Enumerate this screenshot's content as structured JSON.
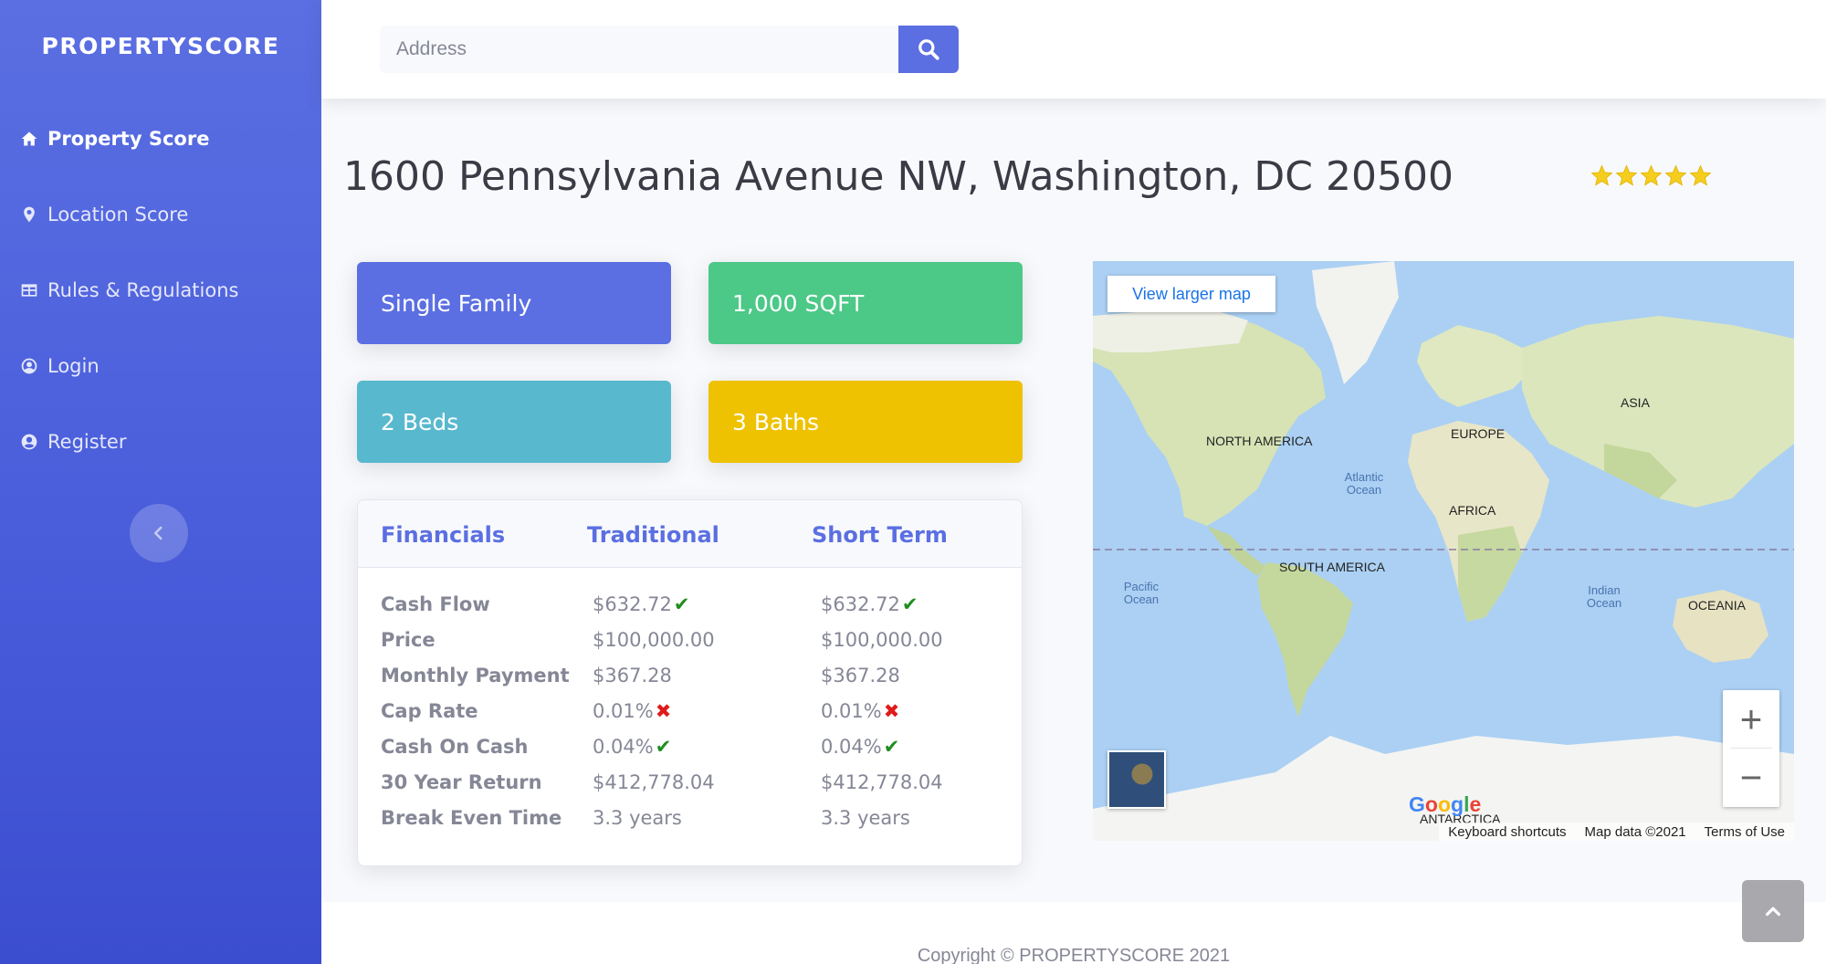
{
  "brand": "PROPERTYSCORE",
  "sidebar": {
    "items": [
      {
        "label": "Property Score",
        "icon": "home-icon"
      },
      {
        "label": "Location Score",
        "icon": "map-marker-icon"
      },
      {
        "label": "Rules & Regulations",
        "icon": "table-icon"
      },
      {
        "label": "Login",
        "icon": "user-circle-icon"
      },
      {
        "label": "Register",
        "icon": "user-icon"
      }
    ]
  },
  "search": {
    "placeholder": "Address",
    "value": ""
  },
  "property": {
    "address": "1600 Pennsylvania Avenue NW, Washington, DC 20500",
    "rating": 5,
    "type": "Single Family",
    "sqft": "1,000 SQFT",
    "beds": "2 Beds",
    "baths": "3 Baths"
  },
  "financials": {
    "headers": [
      "Financials",
      "Traditional",
      "Short Term"
    ],
    "rows": [
      {
        "label": "Cash Flow",
        "traditional": "$632.72",
        "short_term": "$632.72",
        "status": "check"
      },
      {
        "label": "Price",
        "traditional": "$100,000.00",
        "short_term": "$100,000.00",
        "status": ""
      },
      {
        "label": "Monthly Payment",
        "traditional": "$367.28",
        "short_term": "$367.28",
        "status": ""
      },
      {
        "label": "Cap Rate",
        "traditional": "0.01%",
        "short_term": "0.01%",
        "status": "cross"
      },
      {
        "label": "Cash On Cash",
        "traditional": "0.04%",
        "short_term": "0.04%",
        "status": "check"
      },
      {
        "label": "30 Year Return",
        "traditional": "$412,778.04",
        "short_term": "$412,778.04",
        "status": ""
      },
      {
        "label": "Break Even Time",
        "traditional": "3.3 years",
        "short_term": "3.3 years",
        "status": ""
      }
    ]
  },
  "map": {
    "view_larger": "View larger map",
    "zoom_in": "+",
    "zoom_out": "−",
    "footer": [
      "Keyboard shortcuts",
      "Map data ©2021",
      "Terms of Use"
    ],
    "logo": "Google",
    "labels": {
      "north_america": "NORTH AMERICA",
      "south_america": "SOUTH AMERICA",
      "europe": "EUROPE",
      "africa": "AFRICA",
      "asia": "ASIA",
      "oceania": "OCEANIA",
      "antarctica": "ANTARCTICA",
      "atlantic": "Atlantic Ocean",
      "pacific": "Pacific Ocean",
      "indian": "Indian Ocean"
    }
  },
  "footer": {
    "copyright": "Copyright © PROPERTYSCORE 2021"
  },
  "colors": {
    "primary": "#5b6fe2",
    "success": "#4cc887",
    "info": "#58b8ce",
    "warning": "#eec200",
    "check": "#1e8e1e",
    "cross": "#e01b1b",
    "star": "#f5cd1f"
  }
}
